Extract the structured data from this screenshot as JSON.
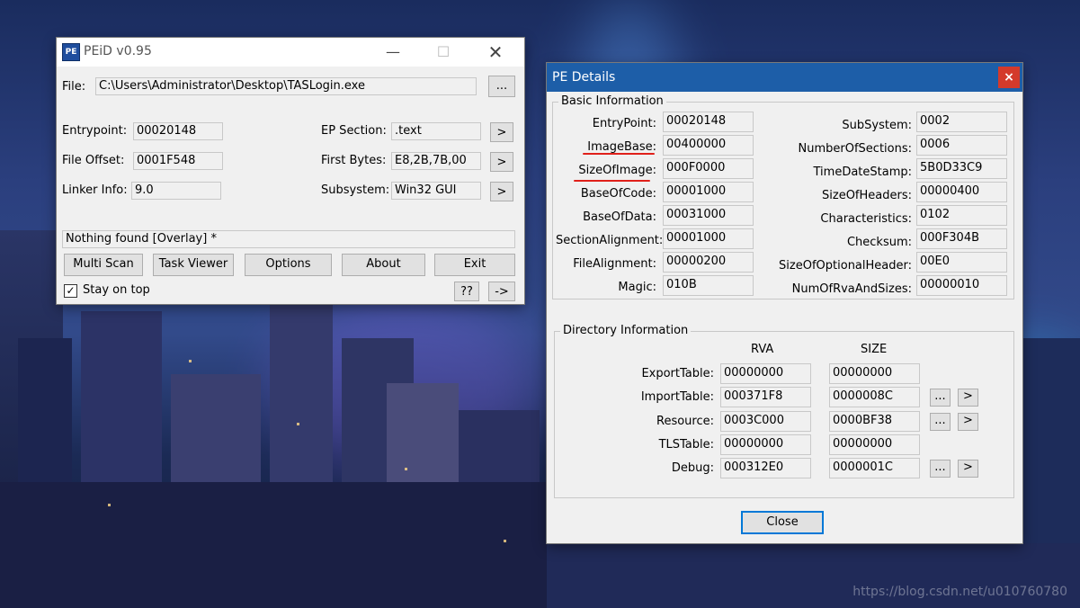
{
  "background": {
    "watermark": "https://blog.csdn.net/u010760780"
  },
  "peid": {
    "title": "PEiD v0.95",
    "file_label": "File:",
    "file_path": "C:\\Users\\Administrator\\Desktop\\TASLogin.exe",
    "browse_label": "...",
    "entrypoint_label": "Entrypoint:",
    "entrypoint": "00020148",
    "file_offset_label": "File Offset:",
    "file_offset": "0001F548",
    "linker_label": "Linker Info:",
    "linker": "9.0",
    "ep_section_label": "EP Section:",
    "ep_section": ".text",
    "first_bytes_label": "First Bytes:",
    "first_bytes": "E8,2B,7B,00",
    "subsystem_label": "Subsystem:",
    "subsystem": "Win32 GUI",
    "arrow": ">",
    "result": "Nothing found [Overlay] *",
    "buttons": {
      "multi_scan": "Multi Scan",
      "task_viewer": "Task Viewer",
      "options": "Options",
      "about": "About",
      "exit": "Exit"
    },
    "stay_on_top": "Stay on top",
    "help": "??",
    "more": "->"
  },
  "pe_details": {
    "title": "PE Details",
    "close_x": "×",
    "basic_title": "Basic Information",
    "left": [
      {
        "label": "EntryPoint:",
        "value": "00020148"
      },
      {
        "label": "ImageBase:",
        "value": "00400000"
      },
      {
        "label": "SizeOfImage:",
        "value": "000F0000"
      },
      {
        "label": "BaseOfCode:",
        "value": "00001000"
      },
      {
        "label": "BaseOfData:",
        "value": "00031000"
      },
      {
        "label": "SectionAlignment:",
        "value": "00001000"
      },
      {
        "label": "FileAlignment:",
        "value": "00000200"
      },
      {
        "label": "Magic:",
        "value": "010B"
      }
    ],
    "right": [
      {
        "label": "SubSystem:",
        "value": "0002"
      },
      {
        "label": "NumberOfSections:",
        "value": "0006"
      },
      {
        "label": "TimeDateStamp:",
        "value": "5B0D33C9"
      },
      {
        "label": "SizeOfHeaders:",
        "value": "00000400"
      },
      {
        "label": "Characteristics:",
        "value": "0102"
      },
      {
        "label": "Checksum:",
        "value": "000F304B"
      },
      {
        "label": "SizeOfOptionalHeader:",
        "value": "00E0"
      },
      {
        "label": "NumOfRvaAndSizes:",
        "value": "00000010"
      }
    ],
    "dir_title": "Directory Information",
    "rva_header": "RVA",
    "size_header": "SIZE",
    "dirs": [
      {
        "label": "ExportTable:",
        "rva": "00000000",
        "size": "00000000"
      },
      {
        "label": "ImportTable:",
        "rva": "000371F8",
        "size": "0000008C"
      },
      {
        "label": "Resource:",
        "rva": "0003C000",
        "size": "0000BF38"
      },
      {
        "label": "TLSTable:",
        "rva": "00000000",
        "size": "00000000"
      },
      {
        "label": "Debug:",
        "rva": "000312E0",
        "size": "0000001C"
      }
    ],
    "dots": "...",
    "arrow": ">",
    "close_label": "Close"
  }
}
